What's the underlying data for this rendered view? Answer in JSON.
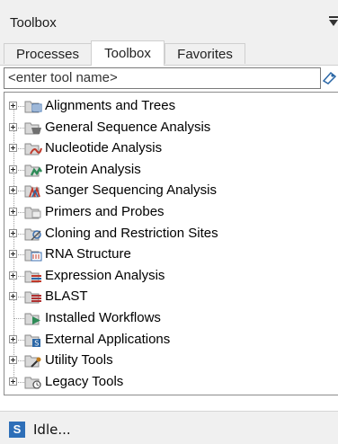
{
  "panel": {
    "title": "Toolbox"
  },
  "tabs": [
    {
      "label": "Processes",
      "active": false
    },
    {
      "label": "Toolbox",
      "active": true
    },
    {
      "label": "Favorites",
      "active": false
    }
  ],
  "search": {
    "placeholder": "<enter tool name>"
  },
  "tree": {
    "items": [
      {
        "label": "Alignments and Trees",
        "icon": "alignments-icon",
        "expandable": true
      },
      {
        "label": "General Sequence Analysis",
        "icon": "general-sequence-icon",
        "expandable": true
      },
      {
        "label": "Nucleotide Analysis",
        "icon": "nucleotide-icon",
        "expandable": true
      },
      {
        "label": "Protein Analysis",
        "icon": "protein-icon",
        "expandable": true
      },
      {
        "label": "Sanger Sequencing Analysis",
        "icon": "sanger-icon",
        "expandable": true
      },
      {
        "label": "Primers and Probes",
        "icon": "primers-icon",
        "expandable": true
      },
      {
        "label": "Cloning and Restriction Sites",
        "icon": "cloning-icon",
        "expandable": true
      },
      {
        "label": "RNA Structure",
        "icon": "rna-icon",
        "expandable": true
      },
      {
        "label": "Expression Analysis",
        "icon": "expression-icon",
        "expandable": true
      },
      {
        "label": "BLAST",
        "icon": "blast-icon",
        "expandable": true
      },
      {
        "label": "Installed Workflows",
        "icon": "workflow-icon",
        "expandable": false
      },
      {
        "label": "External Applications",
        "icon": "external-apps-icon",
        "expandable": true
      },
      {
        "label": "Utility Tools",
        "icon": "utility-icon",
        "expandable": true
      },
      {
        "label": "Legacy Tools",
        "icon": "legacy-icon",
        "expandable": true
      }
    ]
  },
  "status": {
    "icon_letter": "S",
    "text": "Idle..."
  },
  "colors": {
    "accent": "#2e6fb8",
    "folder": "#d9d9d9"
  }
}
